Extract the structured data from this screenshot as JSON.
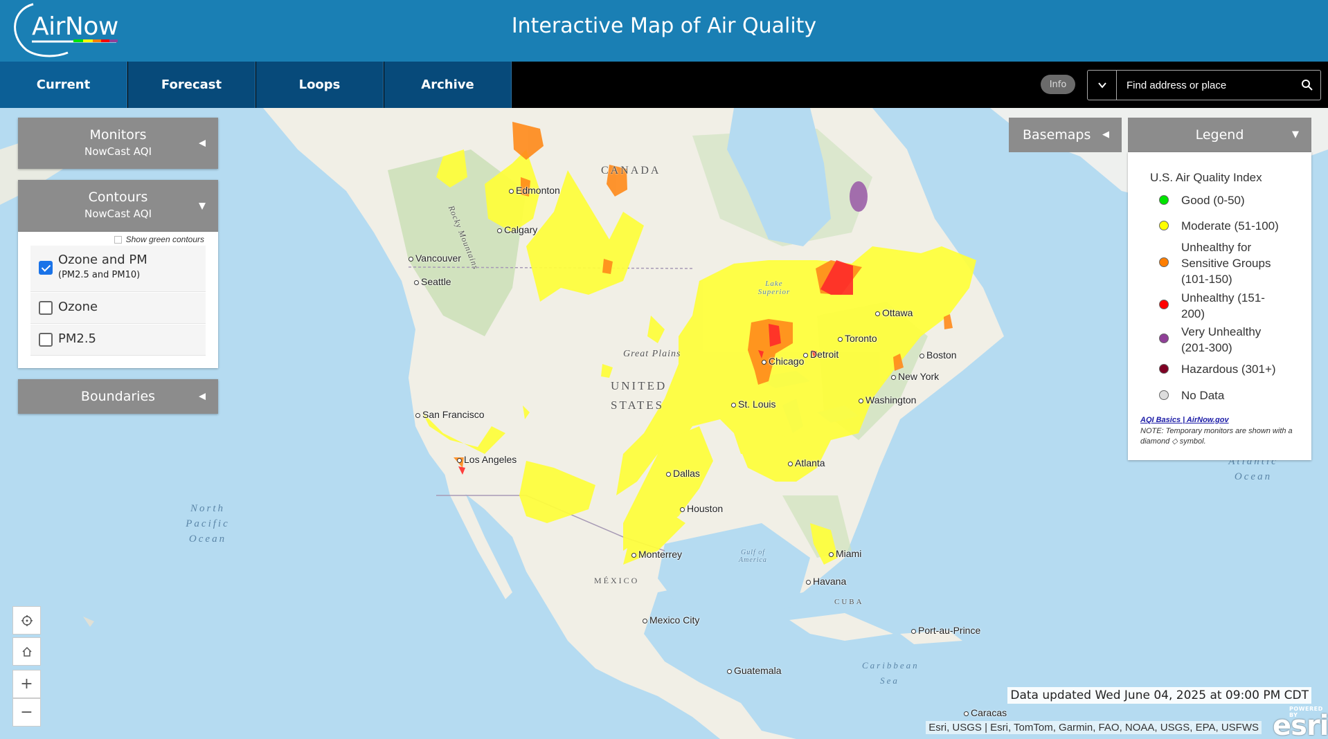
{
  "header": {
    "logo_text": "AirNow",
    "title": "Interactive Map of Air Quality"
  },
  "nav": {
    "tabs": [
      {
        "label": "Current",
        "active": true
      },
      {
        "label": "Forecast",
        "active": false
      },
      {
        "label": "Loops",
        "active": false
      },
      {
        "label": "Archive",
        "active": false
      }
    ],
    "info_label": "Info",
    "search_placeholder": "Find address or place"
  },
  "panels": {
    "monitors": {
      "title": "Monitors",
      "subtitle": "NowCast AQI"
    },
    "contours": {
      "title": "Contours",
      "subtitle": "NowCast AQI",
      "show_green_label": "Show green contours",
      "options": [
        {
          "label": "Ozone and PM",
          "sublabel": "(PM2.5 and PM10)",
          "checked": true
        },
        {
          "label": "Ozone",
          "sublabel": "",
          "checked": false
        },
        {
          "label": "PM2.5",
          "sublabel": "",
          "checked": false
        }
      ]
    },
    "boundaries": {
      "title": "Boundaries"
    }
  },
  "basemaps": {
    "label": "Basemaps"
  },
  "legend": {
    "header": "Legend",
    "title": "U.S. Air Quality Index",
    "items": [
      {
        "label": "Good (0-50)",
        "color": "#00e400"
      },
      {
        "label": "Moderate (51-100)",
        "color": "#ffff00"
      },
      {
        "label": "Unhealthy for Sensitive Groups (101-150)",
        "color": "#ff7e00"
      },
      {
        "label": "Unhealthy (151-200)",
        "color": "#ff0000"
      },
      {
        "label": "Very Unhealthy (201-300)",
        "color": "#8f3f97"
      },
      {
        "label": "Hazardous (301+)",
        "color": "#7e0023"
      },
      {
        "label": "No Data",
        "color": "#dddddd"
      }
    ],
    "link": "AQI Basics | AirNow.gov",
    "note": "NOTE: Temporary monitors are shown with a diamond ◇ symbol."
  },
  "map": {
    "cities": [
      "Edmonton",
      "Calgary",
      "Vancouver",
      "Seattle",
      "San Francisco",
      "Los Angeles",
      "Dallas",
      "Houston",
      "St. Louis",
      "Chicago",
      "Detroit",
      "Toronto",
      "Ottawa",
      "Boston",
      "New York",
      "Washington",
      "Atlanta",
      "Miami",
      "Havana",
      "Monterrey",
      "Mexico City",
      "Guatemala",
      "Port-au-Prince",
      "Caracas"
    ],
    "regions": [
      "CANADA",
      "UNITED STATES",
      "MÉXICO",
      "CUBA",
      "Great Plains",
      "Rocky Mountains",
      "Lake Superior",
      "Gulf of America"
    ],
    "oceans": [
      "North Pacific Ocean",
      "Atlantic Ocean",
      "Caribbean Sea"
    ]
  },
  "status": {
    "data_updated": "Data updated Wed June 04, 2025 at 09:00 PM CDT",
    "attribution": "Esri, USGS | Esri, TomTom, Garmin, FAO, NOAA, USGS, EPA, USFWS",
    "esri_powered": "POWERED BY",
    "esri_logo": "esri"
  }
}
